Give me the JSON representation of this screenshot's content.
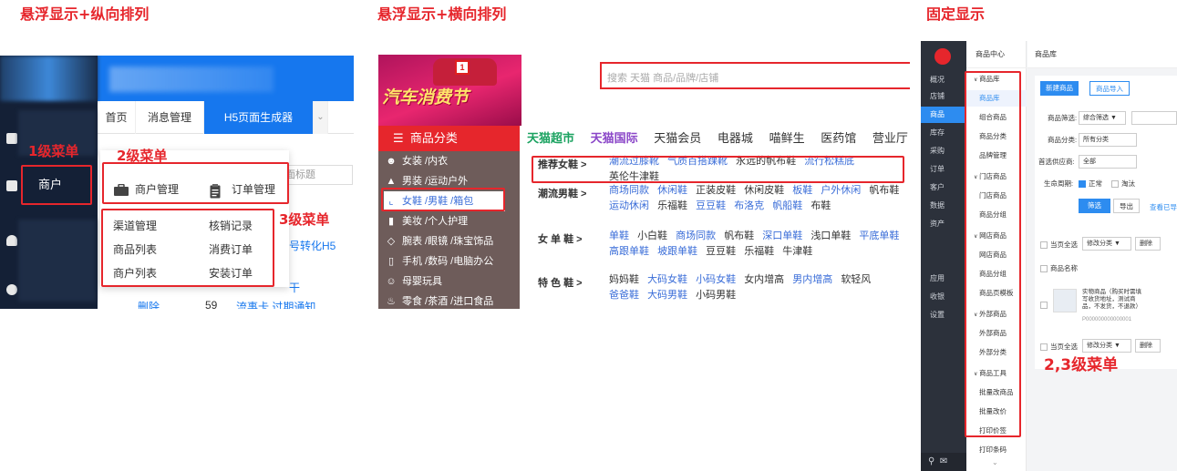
{
  "section_titles": {
    "p1": "悬浮显示+纵向排列",
    "p2": "悬浮显示+横向排列",
    "p3": "固定显示"
  },
  "annotations": {
    "level1": "1级菜单",
    "level2": "2级菜单",
    "level3": "3级菜单",
    "level23": "2,3级菜单"
  },
  "colors": {
    "annotation_red": "#e6262c",
    "admin_blue": "#1677ee",
    "tmall_red": "#e6262c"
  },
  "panel1": {
    "sidebar_active_item": "商户",
    "tabs": [
      {
        "label": "首页"
      },
      {
        "label": "消息管理"
      },
      {
        "label": "H5页面生成器",
        "active": true
      }
    ],
    "tab_dropdown_icon": "chevron-down-icon",
    "level2_items": [
      {
        "label": "商户管理",
        "icon": "briefcase-icon"
      },
      {
        "label": "订单管理",
        "icon": "clipboard-icon"
      }
    ],
    "level3_left": [
      "渠道管理",
      "商品列表",
      "商户列表"
    ],
    "level3_right": [
      "核销记录",
      "消费订单",
      "安装订单"
    ],
    "bg_text": {
      "select_placeholder": "页面标题",
      "link1": "号转化H5",
      "link2": "干",
      "row_delete": "删除",
      "row_num": "59",
      "row_text": "流事卡 过期通知"
    }
  },
  "panel2": {
    "banner_text": "汽车消费节",
    "search_placeholder": "搜索 天猫 商品/品牌/店铺",
    "category_head": "商品分类",
    "categories": [
      {
        "label": "女装 /内衣",
        "icon": "person-icon"
      },
      {
        "label": "男装 /运动户外",
        "icon": "shirt-icon"
      },
      {
        "label": "女鞋 /男鞋 /箱包",
        "icon": "shoe-icon",
        "active": true
      },
      {
        "label": "美妆 /个人护理",
        "icon": "lipstick-icon"
      },
      {
        "label": "腕表 /眼镜 /珠宝饰品",
        "icon": "diamond-icon"
      },
      {
        "label": "手机 /数码 /电脑办公",
        "icon": "phone-icon"
      },
      {
        "label": "母婴玩具",
        "icon": "baby-icon"
      },
      {
        "label": "零食 /茶酒 /进口食品",
        "icon": "food-icon"
      }
    ],
    "top_nav": [
      {
        "label": "天猫超市",
        "style": "g"
      },
      {
        "label": "天猫国际",
        "style": "p"
      },
      {
        "label": "天猫会员"
      },
      {
        "label": "电器城"
      },
      {
        "label": "喵鲜生"
      },
      {
        "label": "医药馆"
      },
      {
        "label": "营业厅"
      }
    ],
    "sub_sections": [
      {
        "title": "推荐女鞋 >",
        "links": [
          {
            "t": "潮流过膝靴",
            "b": true
          },
          {
            "t": "气质百搭踝靴",
            "b": true
          },
          {
            "t": "永远的帆布鞋"
          },
          {
            "t": "流行松糕底",
            "b": true
          },
          {
            "t": "英伦牛津鞋"
          }
        ]
      },
      {
        "title": "潮流男鞋 >",
        "links": [
          {
            "t": "商场同款",
            "b": true
          },
          {
            "t": "休闲鞋",
            "b": true
          },
          {
            "t": "正装皮鞋"
          },
          {
            "t": "休闲皮鞋"
          },
          {
            "t": "板鞋",
            "b": true
          },
          {
            "t": "户外休闲",
            "b": true
          },
          {
            "t": "帆布鞋"
          },
          {
            "t": "运动休闲",
            "b": true
          },
          {
            "t": "乐福鞋"
          },
          {
            "t": "豆豆鞋",
            "b": true
          },
          {
            "t": "布洛克",
            "b": true
          },
          {
            "t": "帆船鞋",
            "b": true
          },
          {
            "t": "布鞋"
          }
        ]
      },
      {
        "title": "女 单 鞋 >",
        "links": [
          {
            "t": "单鞋",
            "b": true
          },
          {
            "t": "小白鞋"
          },
          {
            "t": "商场同款",
            "b": true
          },
          {
            "t": "帆布鞋"
          },
          {
            "t": "深口单鞋",
            "b": true
          },
          {
            "t": "浅口单鞋"
          },
          {
            "t": "平底单鞋",
            "b": true
          },
          {
            "t": "高跟单鞋",
            "b": true
          },
          {
            "t": "坡跟单鞋",
            "b": true
          },
          {
            "t": "豆豆鞋"
          },
          {
            "t": "乐福鞋"
          },
          {
            "t": "牛津鞋"
          }
        ]
      },
      {
        "title": "特 色 鞋 >",
        "links": [
          {
            "t": "妈妈鞋"
          },
          {
            "t": "大码女鞋",
            "b": true
          },
          {
            "t": "小码女鞋",
            "b": true
          },
          {
            "t": "女内增高"
          },
          {
            "t": "男内增高",
            "b": true
          },
          {
            "t": "软轻风"
          },
          {
            "t": "爸爸鞋",
            "b": true
          },
          {
            "t": "大码男鞋",
            "b": true
          },
          {
            "t": "小码男鞋"
          }
        ]
      }
    ]
  },
  "panel3": {
    "sidebar": [
      {
        "label": "概况"
      },
      {
        "label": "店铺"
      },
      {
        "label": "商品",
        "active": true
      },
      {
        "label": "库存"
      },
      {
        "label": "采购"
      },
      {
        "label": "订单"
      },
      {
        "label": "客户"
      },
      {
        "label": "数据"
      },
      {
        "label": "资产"
      }
    ],
    "sidebar_lower": [
      {
        "label": "应用"
      },
      {
        "label": "收银"
      },
      {
        "label": "设置"
      }
    ],
    "submenu_head": "商品中心",
    "submenu": [
      {
        "label": "商品库",
        "type": "grp"
      },
      {
        "label": "商品库",
        "type": "leaf",
        "active": true
      },
      {
        "label": "组合商品",
        "type": "leaf"
      },
      {
        "label": "商品分类",
        "type": "leaf"
      },
      {
        "label": "品牌管理",
        "type": "leaf"
      },
      {
        "label": "门店商品",
        "type": "grp"
      },
      {
        "label": "门店商品",
        "type": "leaf"
      },
      {
        "label": "商品分组",
        "type": "leaf"
      },
      {
        "label": "网店商品",
        "type": "grp"
      },
      {
        "label": "网店商品",
        "type": "leaf"
      },
      {
        "label": "商品分组",
        "type": "leaf"
      },
      {
        "label": "商品页模板",
        "type": "leaf"
      },
      {
        "label": "外部商品",
        "type": "grp"
      },
      {
        "label": "外部商品",
        "type": "leaf"
      },
      {
        "label": "外部分类",
        "type": "leaf"
      },
      {
        "label": "商品工具",
        "type": "grp"
      },
      {
        "label": "批量改商品",
        "type": "leaf"
      },
      {
        "label": "批量改价",
        "type": "leaf"
      },
      {
        "label": "打印价签",
        "type": "leaf"
      },
      {
        "label": "打印条码",
        "type": "leaf"
      }
    ],
    "breadcrumb": "商品库",
    "btn_new": "新建商品",
    "btn_import": "商品导入",
    "filter": {
      "label1": "商品筛选:",
      "value1": "综合筛选",
      "label2": "商品分类:",
      "value2": "所有分类",
      "label3": "首选供应商:",
      "value3": "全部",
      "label4": "生命周期:",
      "opt_normal": "正常",
      "opt_out": "淘汰",
      "btn_filter": "筛选",
      "btn_export": "导出",
      "link_view": "查看已导"
    },
    "list": {
      "select_all": "当页全选",
      "batch_cat": "修改分类",
      "delete": "删除",
      "col_name": "商品名称",
      "item_name": "实物商品（购买时需填写收货地址，测试商品，不发货，不退款）",
      "item_code": "P000000000000001"
    }
  }
}
